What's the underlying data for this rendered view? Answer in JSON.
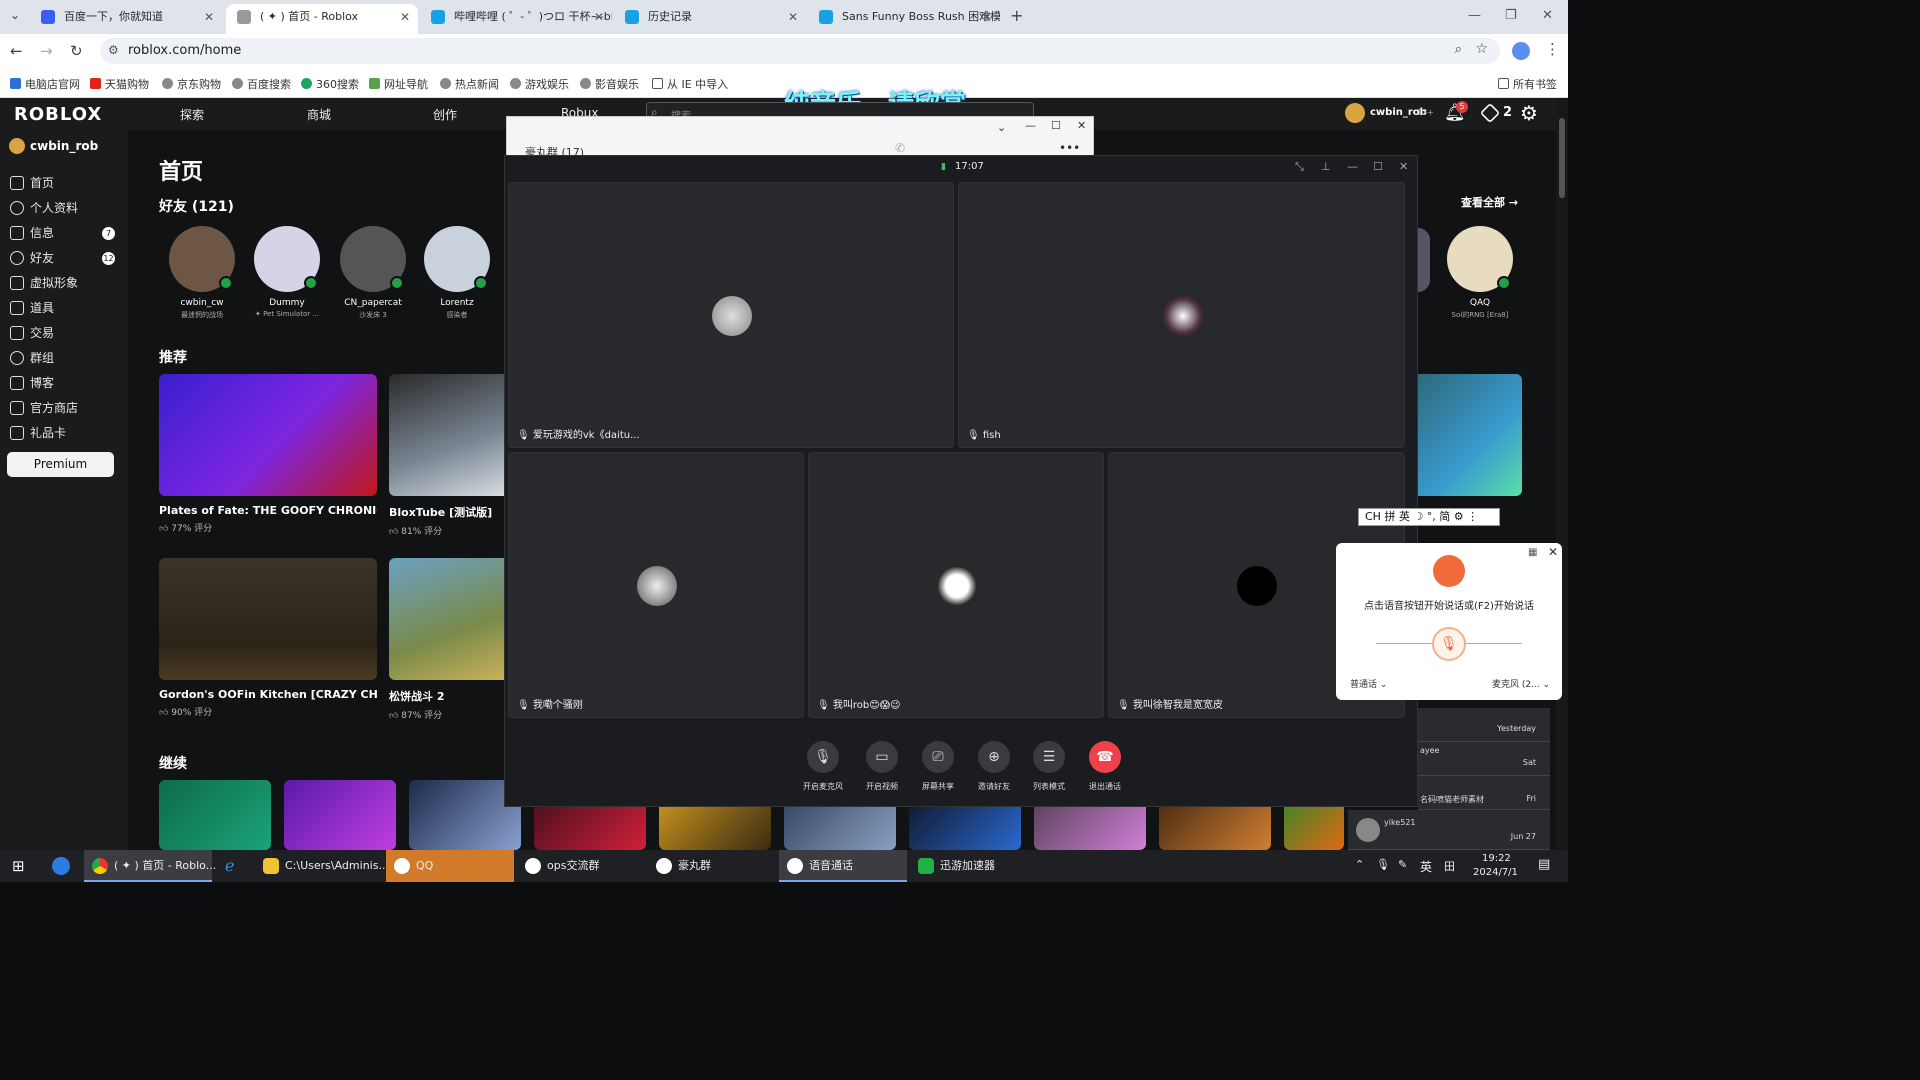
{
  "browser": {
    "tabs": [
      {
        "label": "百度一下，你就知道"
      },
      {
        "label": "( ✦ ) 首页 - Roblox"
      },
      {
        "label": "哔哩哔哩 ( ゜- ゜)つロ 干杯~-bi"
      },
      {
        "label": "历史记录"
      },
      {
        "label": "Sans Funny Boss Rush 困难模"
      }
    ],
    "url": "roblox.com/home",
    "bookmarks": [
      "电脑店官网",
      "天猫购物",
      "京东购物",
      "百度搜索",
      "360搜索",
      "网址导航",
      "热点新闻",
      "游戏娱乐",
      "影音娱乐",
      "从 IE 中导入"
    ],
    "all_bookmarks": "所有书签"
  },
  "overlay_caption": "纯音乐，请欣赏",
  "roblox": {
    "logo": "ROBLOX",
    "nav": [
      "探索",
      "商城",
      "创作",
      "Robux"
    ],
    "search_placeholder": "搜索",
    "user": {
      "name": "cwbin_rob",
      "age": "13+",
      "notif_count": "5",
      "robux": "2"
    },
    "sidebar": {
      "username": "cwbin_rob",
      "items": [
        {
          "label": "首页",
          "badge": ""
        },
        {
          "label": "个人资料",
          "badge": ""
        },
        {
          "label": "信息",
          "badge": "7"
        },
        {
          "label": "好友",
          "badge": "12"
        },
        {
          "label": "虚拟形象",
          "badge": ""
        },
        {
          "label": "道具",
          "badge": ""
        },
        {
          "label": "交易",
          "badge": ""
        },
        {
          "label": "群组",
          "badge": ""
        },
        {
          "label": "博客",
          "badge": ""
        },
        {
          "label": "官方商店",
          "badge": ""
        },
        {
          "label": "礼品卡",
          "badge": ""
        }
      ],
      "premium": "Premium"
    },
    "page_title": "首页",
    "friends_header": "好友 (121)",
    "see_all": "查看全部 →",
    "friends": [
      {
        "name": "cwbin_cw",
        "status": "最迷惘的战场"
      },
      {
        "name": "Dummy",
        "status": "✦ Pet Simulator ..."
      },
      {
        "name": "CN_papercat",
        "status": "沙发床 3"
      },
      {
        "name": "Lorentz",
        "status": "感染者"
      },
      {
        "name": "QAQ",
        "status": "Sol的RNG [Era8]"
      }
    ],
    "recommended_header": "推荐",
    "games": [
      {
        "title": "Plates of Fate: THE GOOFY CHRONIC...",
        "rating": "77% 评分"
      },
      {
        "title": "BloxTube [测试版]",
        "rating": "81% 评分"
      },
      {
        "title": "Gordon's OOFin Kitchen [CRAZY CHE...",
        "rating": "90% 评分"
      },
      {
        "title": "松饼战斗 2",
        "rating": "87% 评分"
      }
    ],
    "continue_header": "继续"
  },
  "qq_group_window": {
    "title": "豪丸群 (17)"
  },
  "call": {
    "time": "17:07",
    "participants": [
      {
        "name": "爱玩游戏的vk《daitu..."
      },
      {
        "name": "fish"
      },
      {
        "name": "我嘞个骚刚"
      },
      {
        "name": "我叫rob😊😱😉"
      },
      {
        "name": "我叫徐智我是宽宽皮"
      }
    ],
    "controls": [
      "开启麦克风",
      "开启视频",
      "屏幕共享",
      "邀请好友",
      "列表模式",
      "退出通话"
    ]
  },
  "ime_bar": "CH 拼 英 ☽ °, 简 ⚙ ⋮",
  "voice_input": {
    "hint": "点击语音按钮开始说话或(F2)开始说话",
    "mode": "普通话",
    "mic": "麦克风 (2..."
  },
  "chat_list": [
    {
      "name": "",
      "time": "Yesterday"
    },
    {
      "name": "ayee",
      "time": "Sat"
    },
    {
      "name": "名码喷猫老师素材",
      "time": "Fri"
    },
    {
      "name": "yike521",
      "time": "Jun 27"
    }
  ],
  "taskbar": {
    "items": [
      "( ✦ ) 首页 - Roblo...",
      "C:\\Users\\Adminis...",
      "QQ",
      "ops交流群",
      "豪丸群",
      "语音通话",
      "迅游加速器"
    ],
    "time": "19:22",
    "date": "2024/7/1",
    "lang": "英"
  },
  "colors": {
    "accent_green": "#24a148",
    "hangup_red": "#f0404a",
    "taskbar_active": "#7aa6e8"
  }
}
